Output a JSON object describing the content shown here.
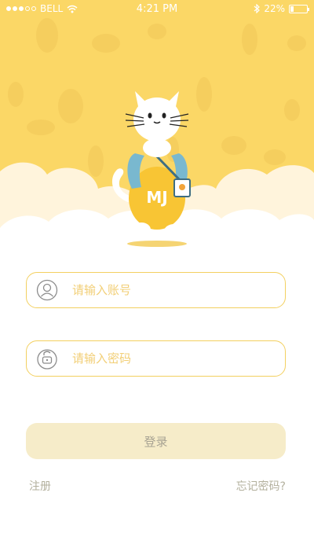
{
  "status_bar": {
    "carrier": "BELL",
    "time": "4:21 PM",
    "battery": "22%",
    "battery_level": 0.22
  },
  "mascot": {
    "shirt_text": "MJ"
  },
  "form": {
    "account_placeholder": "请输入账号",
    "password_placeholder": "请输入密码",
    "login_label": "登录"
  },
  "links": {
    "register": "注册",
    "forgot_password": "忘记密码?"
  },
  "colors": {
    "header_bg": "#fbd766",
    "accent_border": "#f3d060",
    "placeholder": "#f2cf77",
    "button_bg": "#f6ecc9",
    "link_text": "#b3b09d"
  },
  "icons": {
    "wifi": "wifi-icon",
    "bluetooth": "bluetooth-icon",
    "account_field": "user-icon",
    "password_field": "lock-icon"
  }
}
